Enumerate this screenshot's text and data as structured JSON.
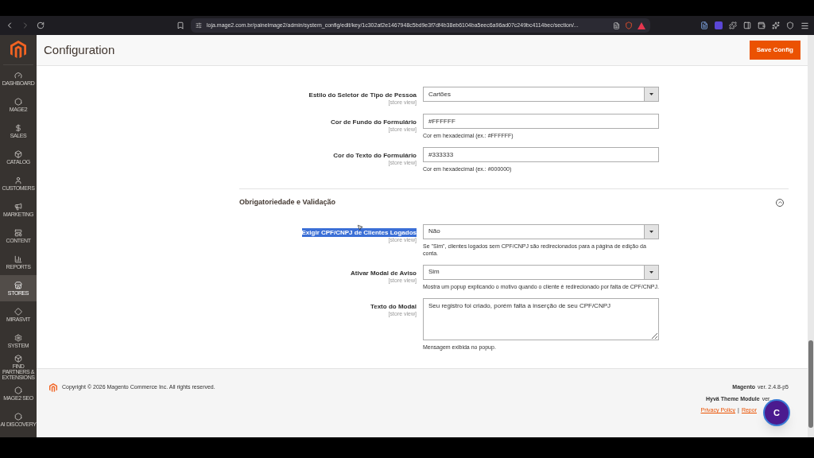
{
  "browser": {
    "url": "loja.mage2.com.br/painelmage2/admin/system_config/edit/key/1c302af2e1467948c5bd9e3f7df4b38eb6104ba5eec6a96ad07c249bc4114bec/section/..."
  },
  "sidebar": {
    "items": [
      {
        "label": "DASHBOARD",
        "selected": false
      },
      {
        "label": "MAGE2",
        "selected": false
      },
      {
        "label": "SALES",
        "selected": false
      },
      {
        "label": "CATALOG",
        "selected": false
      },
      {
        "label": "CUSTOMERS",
        "selected": false
      },
      {
        "label": "MARKETING",
        "selected": false
      },
      {
        "label": "CONTENT",
        "selected": false
      },
      {
        "label": "REPORTS",
        "selected": false
      },
      {
        "label": "STORES",
        "selected": true
      },
      {
        "label": "MIRASVIT",
        "selected": false
      },
      {
        "label": "SYSTEM",
        "selected": false
      },
      {
        "label": "FIND PARTNERS & EXTENSIONS",
        "selected": false
      },
      {
        "label": "MAGE2 SEO",
        "selected": false
      },
      {
        "label": "AI DISCOVERY",
        "selected": false
      }
    ]
  },
  "header": {
    "title": "Configuration",
    "save_button": "Save Config"
  },
  "sections": [
    {
      "fields": [
        {
          "kind": "select",
          "label": "Estilo do Seletor de Tipo de Pessoa",
          "scope": "[store view]",
          "value": "Cartões",
          "highlighted": false
        },
        {
          "kind": "text",
          "label": "Cor de Fundo do Formulário",
          "scope": "[store view]",
          "value": "#FFFFFF",
          "note": "Cor em hexadecimal (ex.: #FFFFFF)",
          "highlighted": false
        },
        {
          "kind": "text",
          "label": "Cor do Texto do Formulário",
          "scope": "[store view]",
          "value": "#333333",
          "note": "Cor em hexadecimal (ex.: #000000)",
          "highlighted": false
        }
      ]
    },
    {
      "title": "Obrigatoriedade e Validação",
      "expanded": true,
      "fields": [
        {
          "kind": "select",
          "label": "Exigir CPF/CNPJ de Clientes Logados",
          "scope": "[store view]",
          "value": "Não",
          "note": "Se \"Sim\", clientes logados sem CPF/CNPJ são redirecionados para a página de edição da conta.",
          "highlighted": true
        },
        {
          "kind": "select",
          "label": "Ativar Modal de Aviso",
          "scope": "[store view]",
          "value": "Sim",
          "note": "Mostra um popup explicando o motivo quando o cliente é redirecionado por falta de CPF/CNPJ.",
          "highlighted": false
        },
        {
          "kind": "textarea",
          "label": "Texto do Modal",
          "scope": "[store view]",
          "value": "Seu registro foi criado, porém falta a inserção de seu CPF/CNPJ",
          "note": "Mensagem exibida no popup.",
          "highlighted": false
        }
      ]
    }
  ],
  "footer": {
    "copyright": "Copyright © 2026 Magento Commerce Inc. All rights reserved.",
    "version_name": "Magento",
    "version": "ver. 2.4.8-p5",
    "theme_name": "Hyvä Theme Module",
    "theme_version": "ver.",
    "links": [
      "Privacy Policy",
      "Repor"
    ],
    "separator": "|"
  },
  "chat_bubble": {
    "letter": "C"
  }
}
